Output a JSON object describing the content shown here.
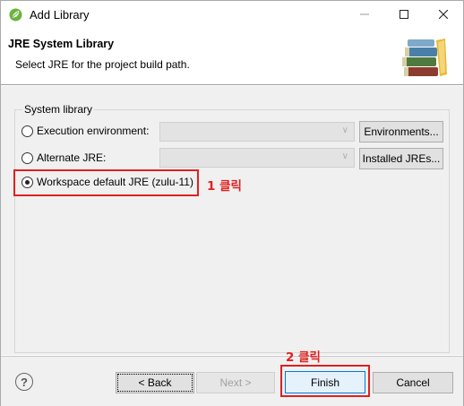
{
  "window": {
    "title": "Add Library",
    "icon": "spring-leaf-icon",
    "controls": [
      "minimize-icon",
      "maximize-icon",
      "close-icon"
    ]
  },
  "banner": {
    "title": "JRE System Library",
    "message": "Select JRE for the project build path.",
    "image": "books-stack-icon"
  },
  "group": {
    "label": "System library",
    "options": [
      {
        "label": "Execution environment:",
        "combo_value": "",
        "button": "Environments...",
        "checked": false,
        "combo_enabled": false
      },
      {
        "label": "Alternate JRE:",
        "combo_value": "",
        "button": "Installed JREs...",
        "checked": false,
        "combo_enabled": false
      },
      {
        "label": "Workspace default JRE (zulu-11)",
        "checked": true
      }
    ]
  },
  "annotations": {
    "step1": "1 클릭",
    "step2": "2 클릭"
  },
  "footer": {
    "help_icon": "help-icon",
    "back": "< Back",
    "next": "Next >",
    "finish": "Finish",
    "cancel": "Cancel"
  },
  "colors": {
    "annotation_red": "#e02020",
    "focus_blue": "#0078d7",
    "dialog_gray": "#f0f0f0"
  }
}
